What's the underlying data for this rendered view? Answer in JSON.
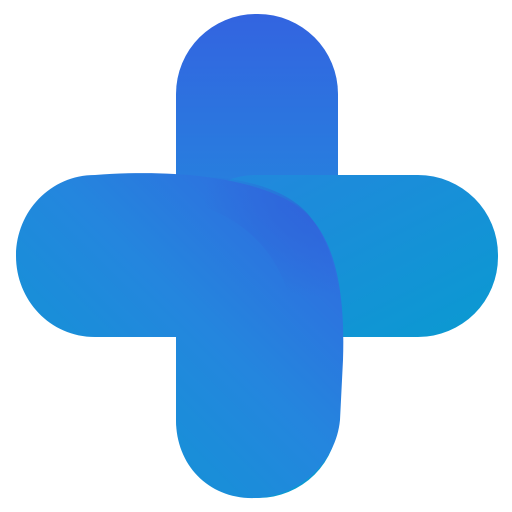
{
  "logo": {
    "icon": "medical-plus-cross-icon",
    "colors": {
      "background": "#ffffff",
      "deep_blue": "#3364e0",
      "mid_blue": "#2486de",
      "cyan": "#0a9ad1",
      "shadow_blue": "#2f62d9"
    }
  }
}
